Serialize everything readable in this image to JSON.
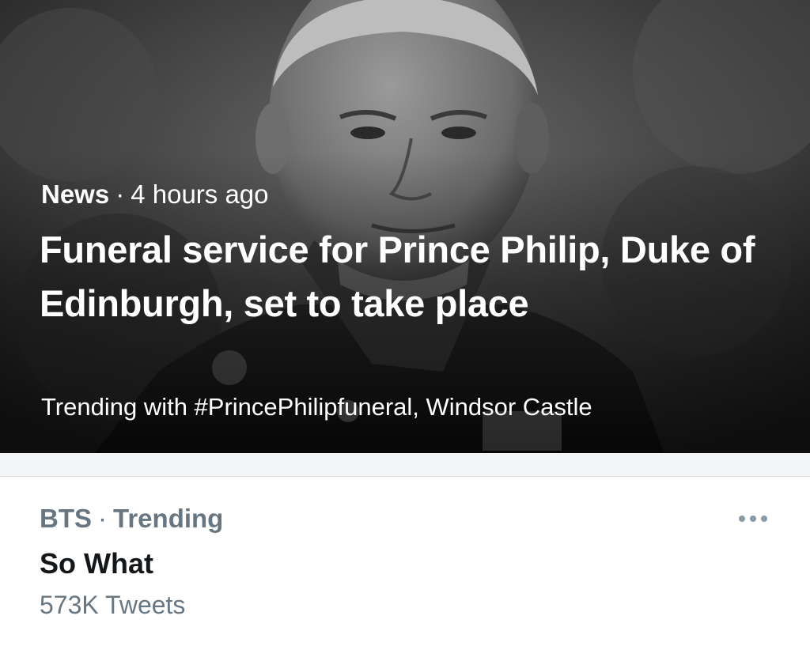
{
  "hero": {
    "category": "News",
    "separator": "·",
    "time": "4 hours ago",
    "title": "Funeral service for Prince Philip, Duke of Edinburgh, set to take place",
    "trending_line": "Trending with #PrincePhilipfuneral, Windsor Castle",
    "image_icon": "portrait-photo"
  },
  "trend_item": {
    "context_topic": "BTS",
    "separator": "·",
    "context_label": "Trending",
    "name": "So What",
    "count": "573K Tweets",
    "more_icon": "more-horizontal-icon"
  },
  "colors": {
    "secondary_text": "#687682",
    "primary_text": "#14171a",
    "hero_text": "#ffffff",
    "separator_bg": "#f4f5f7"
  }
}
